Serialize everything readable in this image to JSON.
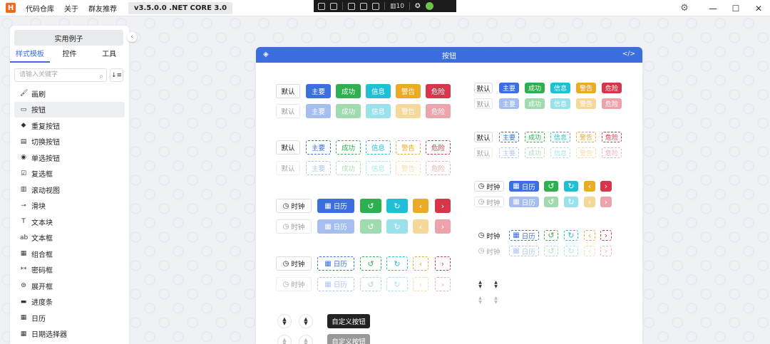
{
  "titlebar": {
    "logo": "H",
    "menu": [
      "代码仓库",
      "关于",
      "群友推荐"
    ],
    "version": "v3.5.0.0 .NET CORE 3.0",
    "debug_fps": "10"
  },
  "sidebar": {
    "sample_button": "实用例子",
    "tabs": [
      "样式模板",
      "控件",
      "工具"
    ],
    "search_placeholder": "请输入关键字",
    "items": [
      {
        "label": "画刷",
        "icon": "brush-icon",
        "glyph": "🖌"
      },
      {
        "label": "按钮",
        "icon": "button-icon",
        "glyph": "▭"
      },
      {
        "label": "重复按钮",
        "icon": "repeat-button-icon",
        "glyph": "◆"
      },
      {
        "label": "切换按钮",
        "icon": "toggle-button-icon",
        "glyph": "▤"
      },
      {
        "label": "单选按钮",
        "icon": "radio-icon",
        "glyph": "◉"
      },
      {
        "label": "复选框",
        "icon": "checkbox-icon",
        "glyph": "☑"
      },
      {
        "label": "滚动视图",
        "icon": "scrollview-icon",
        "glyph": "▥"
      },
      {
        "label": "滑块",
        "icon": "slider-icon",
        "glyph": "⊸"
      },
      {
        "label": "文本块",
        "icon": "textblock-icon",
        "glyph": "T"
      },
      {
        "label": "文本框",
        "icon": "textbox-icon",
        "glyph": "ab"
      },
      {
        "label": "组合框",
        "icon": "combobox-icon",
        "glyph": "▦"
      },
      {
        "label": "密码框",
        "icon": "password-icon",
        "glyph": "**"
      },
      {
        "label": "展开框",
        "icon": "expander-icon",
        "glyph": "⊜"
      },
      {
        "label": "进度条",
        "icon": "progress-icon",
        "glyph": "▬"
      },
      {
        "label": "日历",
        "icon": "calendar-icon",
        "glyph": "▦"
      },
      {
        "label": "日期选择器",
        "icon": "datepicker-icon",
        "glyph": "▦"
      }
    ]
  },
  "card": {
    "title": "按钮",
    "code_toggle": "</>"
  },
  "buttons": {
    "default": "默认",
    "primary": "主要",
    "success": "成功",
    "info": "信息",
    "warning": "警告",
    "danger": "危险",
    "clock": "时钟",
    "calendar": "日历",
    "custom": "自定义按钮"
  },
  "colors": {
    "primary": "#3b6fe0",
    "success": "#2fb050",
    "info": "#1fc0d6",
    "warning": "#e9ac24",
    "danger": "#d7354a"
  }
}
